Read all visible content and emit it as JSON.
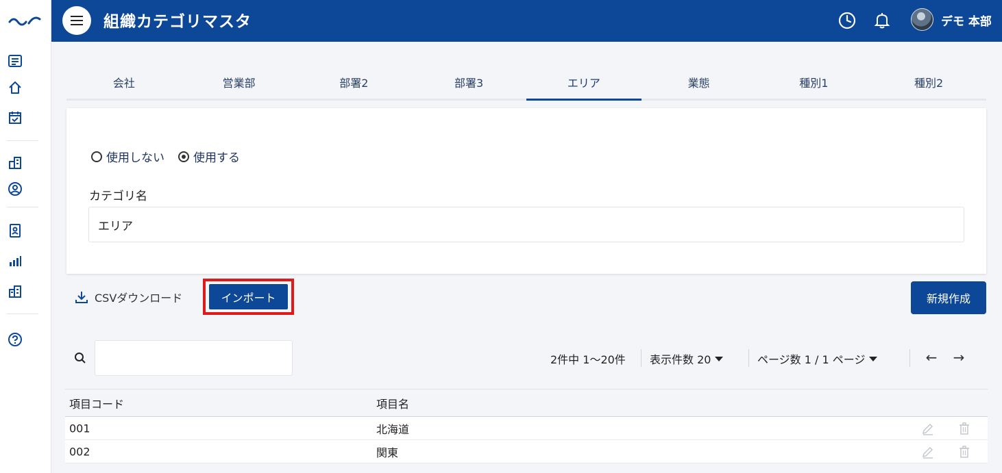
{
  "header": {
    "title": "組織カテゴリマスタ",
    "user_name": "デモ 本部"
  },
  "sidebar": {
    "items": [
      {
        "icon": "list-icon"
      },
      {
        "icon": "home-icon"
      },
      {
        "icon": "calendar-check-icon"
      },
      {
        "icon": "building-icon"
      },
      {
        "icon": "user-circle-icon"
      },
      {
        "icon": "id-badge-icon"
      },
      {
        "icon": "bar-chart-icon"
      },
      {
        "icon": "office-icon"
      },
      {
        "icon": "help-icon"
      }
    ]
  },
  "tabs": [
    {
      "label": "会社"
    },
    {
      "label": "営業部"
    },
    {
      "label": "部署2"
    },
    {
      "label": "部署3"
    },
    {
      "label": "エリア"
    },
    {
      "label": "業態"
    },
    {
      "label": "種別1"
    },
    {
      "label": "種別2"
    }
  ],
  "active_tab": "エリア",
  "form": {
    "radio_off": "使用しない",
    "radio_on": "使用する",
    "selected": "使用する",
    "category_label": "カテゴリ名",
    "category_value": "エリア"
  },
  "actions": {
    "csv_label": "CSVダウンロード",
    "import_label": "インポート",
    "new_label": "新規作成"
  },
  "search": {
    "value": ""
  },
  "pagination": {
    "summary": "2件中 1〜20件",
    "per_page": "表示件数 20",
    "page": "ページ数 1 / 1 ページ",
    "prev": "←",
    "next": "→"
  },
  "table": {
    "columns": [
      "項目コード",
      "項目名"
    ],
    "rows": [
      {
        "code": "001",
        "name": "北海道"
      },
      {
        "code": "002",
        "name": "関東"
      }
    ]
  },
  "colors": {
    "primary": "#0d4798",
    "highlight": "#e0191b"
  }
}
